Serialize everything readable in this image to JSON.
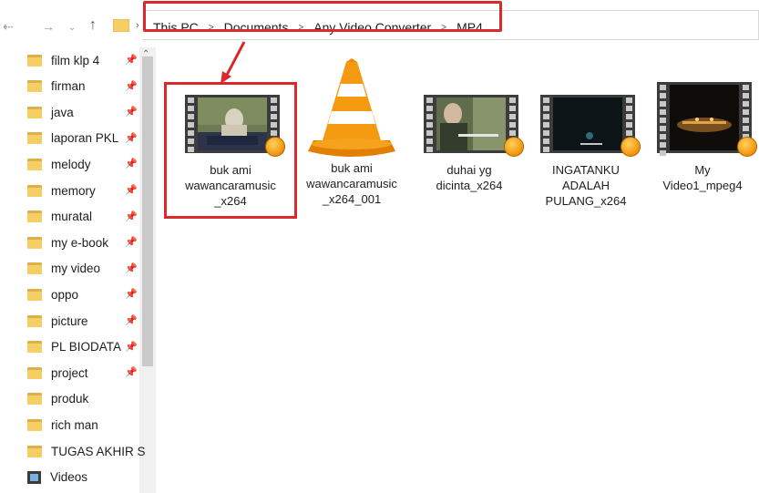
{
  "breadcrumb": [
    "This PC",
    "Documents",
    "Any Video Converter",
    "MP4"
  ],
  "sidebar": {
    "items": [
      {
        "label": "film klp 4",
        "pinned": true
      },
      {
        "label": "firman",
        "pinned": true
      },
      {
        "label": "java",
        "pinned": true
      },
      {
        "label": "laporan PKL",
        "pinned": true
      },
      {
        "label": "melody",
        "pinned": true
      },
      {
        "label": "memory",
        "pinned": true
      },
      {
        "label": "muratal",
        "pinned": true
      },
      {
        "label": "my e-book",
        "pinned": true
      },
      {
        "label": "my video",
        "pinned": true
      },
      {
        "label": "oppo",
        "pinned": true
      },
      {
        "label": "picture",
        "pinned": true
      },
      {
        "label": "PL BIODATA",
        "pinned": true
      },
      {
        "label": "project",
        "pinned": true
      },
      {
        "label": "produk",
        "pinned": false
      },
      {
        "label": "rich man",
        "pinned": false
      },
      {
        "label": "TUGAS AKHIR S",
        "pinned": false
      },
      {
        "label": "Videos",
        "pinned": false,
        "icon": "videos-library-icon"
      }
    ]
  },
  "files": [
    {
      "line1": "buk ami",
      "line2": "wawancaramusic",
      "line3": "_x264",
      "icon": "video-thumbnail-icon"
    },
    {
      "line1": "buk ami",
      "line2": "wawancaramusic",
      "line3": "_x264_001",
      "icon": "vlc-cone-icon"
    },
    {
      "line1": "duhai yg",
      "line2": "dicinta_x264",
      "line3": "",
      "icon": "video-thumbnail-icon"
    },
    {
      "line1": "INGATANKU",
      "line2": "ADALAH",
      "line3": "PULANG_x264",
      "icon": "video-thumbnail-icon"
    },
    {
      "line1": "My",
      "line2": "Video1_mpeg4",
      "line3": "",
      "icon": "video-thumbnail-icon"
    }
  ],
  "colors": {
    "highlight": "#d9292c",
    "folder": "#f5cf63",
    "vlc_orange": "#f08a00"
  }
}
